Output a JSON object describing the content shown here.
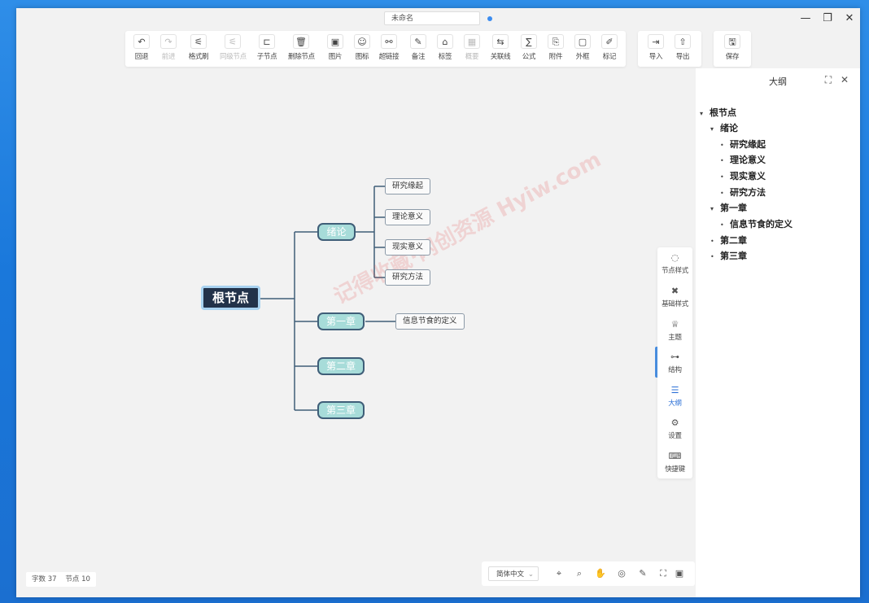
{
  "window": {
    "doc_title": "未命名",
    "minimize_icon": "minimize-icon",
    "restore_icon": "restore-icon",
    "close_icon": "close-icon"
  },
  "toolbar": {
    "main": [
      {
        "label": "回退",
        "icon": "↶",
        "disabled": false
      },
      {
        "label": "前进",
        "icon": "↷",
        "disabled": true
      },
      {
        "label": "格式刷",
        "icon": "⚟",
        "disabled": false
      },
      {
        "label": "同级节点",
        "icon": "⚟",
        "disabled": true
      },
      {
        "label": "子节点",
        "icon": "⊏",
        "disabled": false
      },
      {
        "label": "删除节点",
        "icon": "🗑",
        "disabled": false
      },
      {
        "label": "图片",
        "icon": "▣",
        "disabled": false
      },
      {
        "label": "图标",
        "icon": "☺",
        "disabled": false
      },
      {
        "label": "超链接",
        "icon": "⚯",
        "disabled": false
      },
      {
        "label": "备注",
        "icon": "✎",
        "disabled": false
      },
      {
        "label": "标签",
        "icon": "⌂",
        "disabled": false
      },
      {
        "label": "概要",
        "icon": "▦",
        "disabled": true
      },
      {
        "label": "关联线",
        "icon": "⇆",
        "disabled": false
      },
      {
        "label": "公式",
        "icon": "∑",
        "disabled": false
      },
      {
        "label": "附件",
        "icon": "⎘",
        "disabled": false
      },
      {
        "label": "外框",
        "icon": "▢",
        "disabled": false
      },
      {
        "label": "标记",
        "icon": "✐",
        "disabled": false
      }
    ],
    "io": [
      {
        "label": "导入",
        "icon": "⇥"
      },
      {
        "label": "导出",
        "icon": "⇧"
      }
    ],
    "save": {
      "label": "保存",
      "icon": "🖫"
    }
  },
  "mindmap": {
    "root": "根节点",
    "branches": [
      {
        "label": "绪论",
        "children": [
          "研究缘起",
          "理论意义",
          "现实意义",
          "研究方法"
        ]
      },
      {
        "label": "第一章",
        "children": [
          "信息节食的定义"
        ]
      },
      {
        "label": "第二章",
        "children": []
      },
      {
        "label": "第三章",
        "children": []
      }
    ]
  },
  "watermark": "记得收藏·网创资源 Hyiw.com",
  "status": {
    "word_count_label": "字数",
    "word_count": "37",
    "node_count_label": "节点",
    "node_count": "10"
  },
  "bottom_bar": {
    "language": "简体中文",
    "icons": [
      "locate-icon",
      "search-icon",
      "hand-icon",
      "compass-icon",
      "edit-icon",
      "fit-screen-icon",
      "fullscreen-icon"
    ]
  },
  "side_panel": {
    "items": [
      {
        "label": "节点样式",
        "icon": "◌",
        "active": false
      },
      {
        "label": "基础样式",
        "icon": "✖",
        "active": false
      },
      {
        "label": "主题",
        "icon": "♕",
        "active": false
      },
      {
        "label": "结构",
        "icon": "⊶",
        "active": false
      },
      {
        "label": "大纲",
        "icon": "☰",
        "active": true
      },
      {
        "label": "设置",
        "icon": "⚙",
        "active": false
      },
      {
        "label": "快捷键",
        "icon": "⌨",
        "active": false
      }
    ]
  },
  "outline": {
    "title": "大纲",
    "rows": [
      {
        "text": "根节点",
        "level": 0,
        "mark": "▾"
      },
      {
        "text": "绪论",
        "level": 1,
        "mark": "▾"
      },
      {
        "text": "研究缘起",
        "level": 2,
        "mark": "•"
      },
      {
        "text": "理论意义",
        "level": 2,
        "mark": "•"
      },
      {
        "text": "现实意义",
        "level": 2,
        "mark": "•"
      },
      {
        "text": "研究方法",
        "level": 2,
        "mark": "•"
      },
      {
        "text": "第一章",
        "level": 1,
        "mark": "▾"
      },
      {
        "text": "信息节食的定义",
        "level": 2,
        "mark": "•"
      },
      {
        "text": "第二章",
        "level": 1,
        "mark": "•"
      },
      {
        "text": "第三章",
        "level": 1,
        "mark": "•"
      }
    ]
  }
}
